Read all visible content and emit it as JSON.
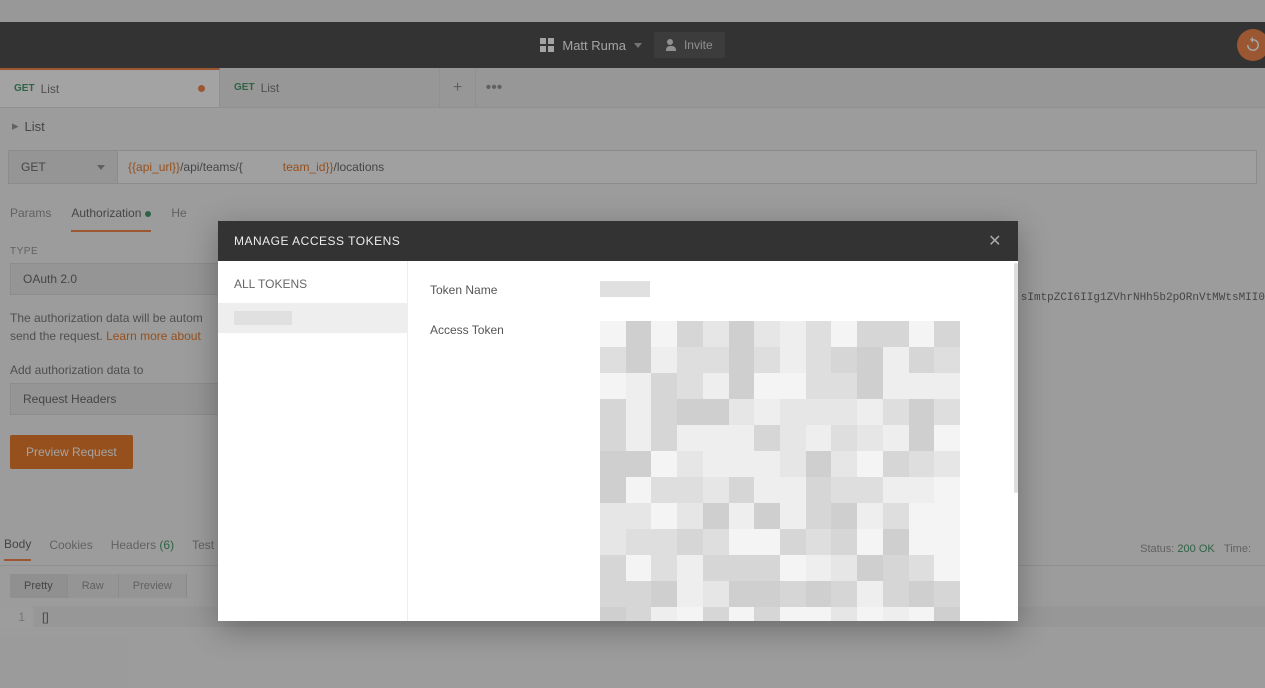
{
  "header": {
    "username": "Matt Ruma",
    "invite_label": "Invite"
  },
  "tabs": [
    {
      "method": "GET",
      "label": "List",
      "dirty": true
    },
    {
      "method": "GET",
      "label": "List",
      "dirty": false
    }
  ],
  "request": {
    "title": "List",
    "method": "GET",
    "url_parts": {
      "var1": "{{api_url}}",
      "mid": "/api/teams/{",
      "var2": "team_id}}",
      "tail": "/locations"
    }
  },
  "subtabs": {
    "params": "Params",
    "authorization": "Authorization",
    "headers": "He"
  },
  "auth": {
    "type_label": "TYPE",
    "type_value": "OAuth 2.0",
    "note_prefix": "The authorization data will be autom",
    "note_suffix": "send the request. ",
    "learn_more": "Learn more about",
    "addto_label": "Add authorization data to",
    "addto_value": "Request Headers",
    "preview_button": "Preview Request"
  },
  "token_overflow": "sImtpZCI6IIg1ZVhrNHh5b2pORnVtMWtsMII0",
  "response": {
    "tabs": {
      "body": "Body",
      "cookies": "Cookies",
      "headers": "Headers",
      "headers_count": "(6)",
      "tests": "Test"
    },
    "status_label": "Status:",
    "status_code": "200 OK",
    "time_label": "Time:",
    "view": {
      "pretty": "Pretty",
      "raw": "Raw",
      "preview": "Preview"
    },
    "body_text": "[]"
  },
  "modal": {
    "title": "MANAGE ACCESS TOKENS",
    "all_tokens": "ALL TOKENS",
    "token_name_label": "Token Name",
    "access_token_label": "Access Token"
  }
}
